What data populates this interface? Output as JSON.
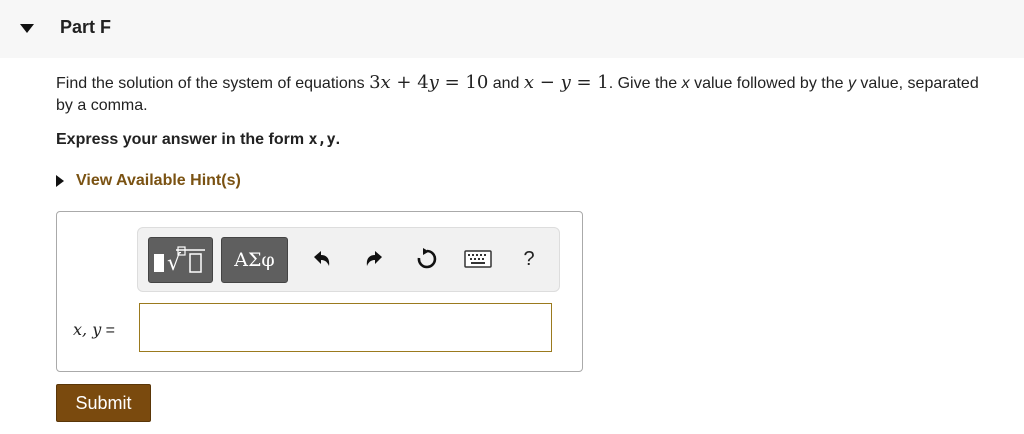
{
  "part": {
    "title": "Part F"
  },
  "question": {
    "t1": "Find the solution of the system of equations ",
    "eq1_a": "3",
    "eq1_x": "x",
    "eq1_plus": " + 4",
    "eq1_y": "y",
    "eq1_rhs": " = 10",
    "t2": " and ",
    "eq2_x": "x",
    "eq2_minus": " − ",
    "eq2_y": "y",
    "eq2_rhs": " = 1",
    "t3": ". Give the ",
    "xvar": "x",
    "t4": " value followed by the ",
    "yvar": "y",
    "t5": " value, separated by a comma."
  },
  "express": {
    "prefix": "Express your answer in the form ",
    "form": "x,y",
    "suffix": "."
  },
  "hint": {
    "label": "View Available Hint(s)"
  },
  "toolbar": {
    "templates_label": "√",
    "symbols_label": "ΑΣφ",
    "undo_icon": "undo-icon",
    "redo_icon": "redo-icon",
    "reset_icon": "reset-icon",
    "keyboard_icon": "keyboard-icon",
    "help_label": "?"
  },
  "answer": {
    "label_vars": "x, y",
    "label_eq": " =",
    "value": "",
    "placeholder": ""
  },
  "submit": {
    "label": "Submit"
  }
}
